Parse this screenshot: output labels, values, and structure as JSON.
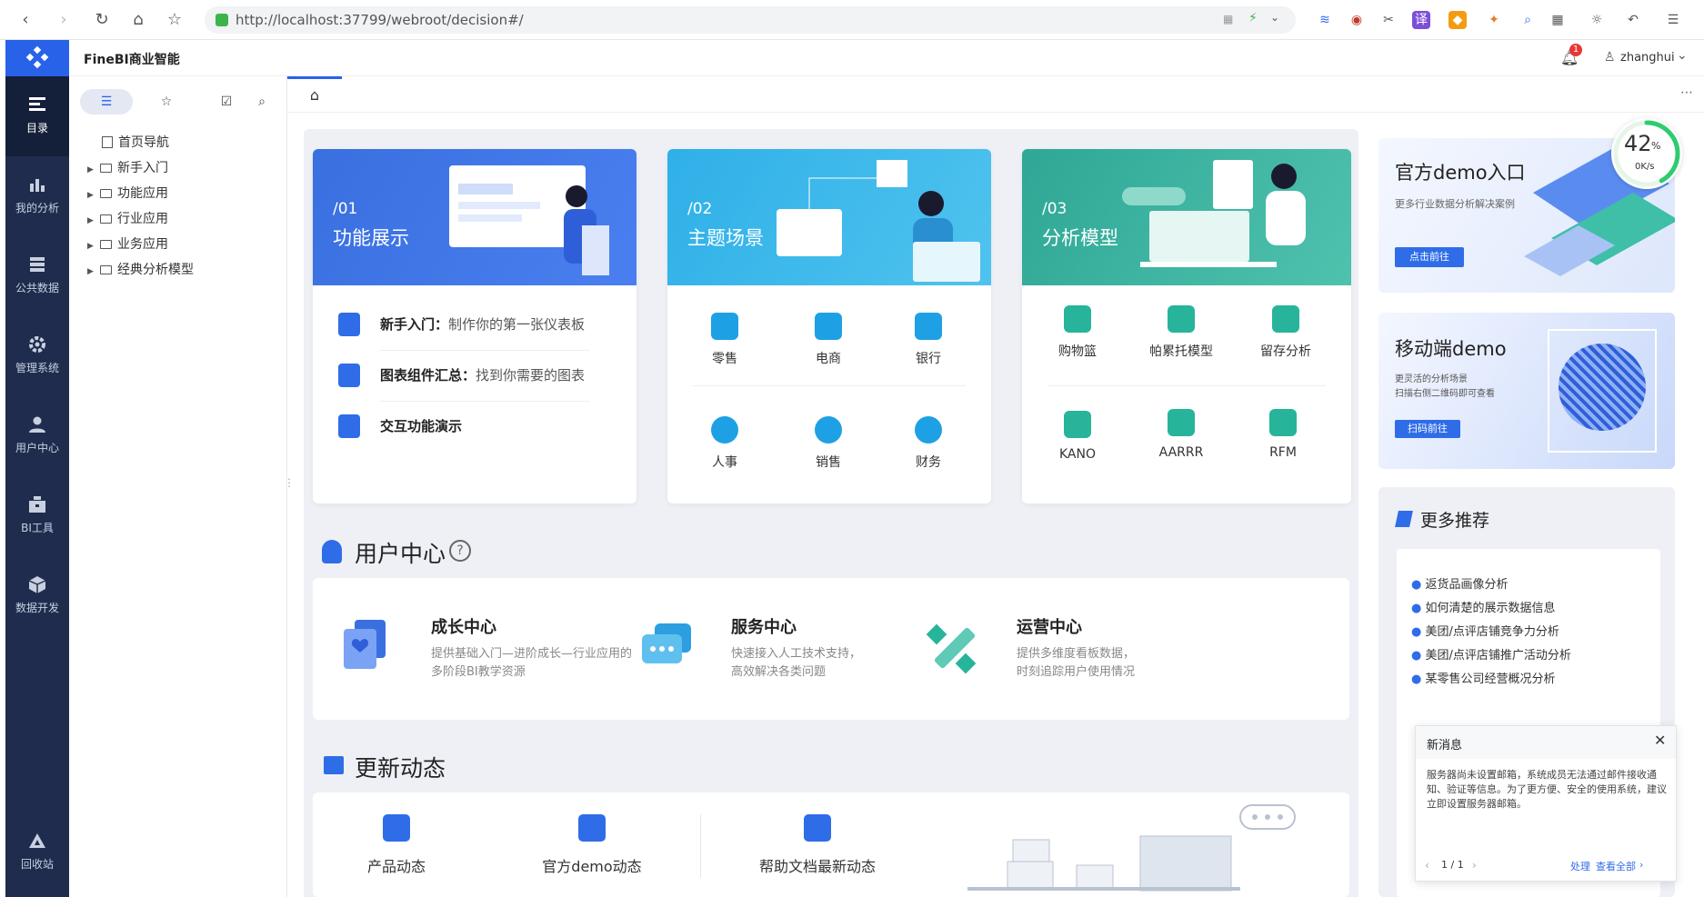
{
  "browser": {
    "url": "http://localhost:37799/webroot/decision#/"
  },
  "app": {
    "title": "FineBI商业智能",
    "user": "zhanghui",
    "notification_count": "1"
  },
  "rail": {
    "items": [
      {
        "label": "目录"
      },
      {
        "label": "我的分析"
      },
      {
        "label": "公共数据"
      },
      {
        "label": "管理系统"
      },
      {
        "label": "用户中心"
      },
      {
        "label": "BI工具"
      },
      {
        "label": "数据开发"
      }
    ],
    "bottom": {
      "label": "回收站"
    }
  },
  "directory": {
    "tree": [
      {
        "label": "首页导航"
      },
      {
        "label": "新手入门"
      },
      {
        "label": "功能应用"
      },
      {
        "label": "行业应用"
      },
      {
        "label": "业务应用"
      },
      {
        "label": "经典分析模型"
      }
    ]
  },
  "hero": {
    "cards": [
      {
        "num": "/01",
        "title": "功能展示",
        "rows": [
          {
            "bold": "新手入门：",
            "text": "制作你的第一张仪表板"
          },
          {
            "bold": "图表组件汇总：",
            "text": "找到你需要的图表"
          },
          {
            "bold": "交互功能演示",
            "text": ""
          }
        ]
      },
      {
        "num": "/02",
        "title": "主题场景",
        "items": [
          "零售",
          "电商",
          "银行",
          "人事",
          "销售",
          "财务"
        ]
      },
      {
        "num": "/03",
        "title": "分析模型",
        "items": [
          "购物篮",
          "帕累托模型",
          "留存分析",
          "KANO",
          "AARRR",
          "RFM"
        ]
      }
    ]
  },
  "user_center": {
    "title": "用户中心",
    "help": "?",
    "items": [
      {
        "title": "成长中心",
        "desc1": "提供基础入门—进阶成长—行业应用的",
        "desc2": "多阶段BI教学资源"
      },
      {
        "title": "服务中心",
        "desc1": "快速接入人工技术支持，",
        "desc2": "高效解决各类问题"
      },
      {
        "title": "运营中心",
        "desc1": "提供多维度看板数据，",
        "desc2": "时刻追踪用户使用情况"
      }
    ]
  },
  "updates": {
    "title": "更新动态",
    "items": [
      "产品动态",
      "官方demo动态",
      "帮助文档最新动态"
    ]
  },
  "right": {
    "demo": {
      "title": "官方demo入口",
      "desc": "更多行业数据分析解决案例",
      "button": "点击前往"
    },
    "mobile": {
      "title": "移动端demo",
      "desc1": "更灵活的分析场景",
      "desc2": "扫描右侧二维码即可查看",
      "button": "扫码前往"
    },
    "more": {
      "title": "更多推荐",
      "items": [
        "返货品画像分析",
        "如何清楚的展示数据信息",
        "美团/点评店铺竞争力分析",
        "美团/点评店铺推广活动分析",
        "某零售公司经营概况分析"
      ]
    },
    "gauge": {
      "percent": "42",
      "unit": "%",
      "speed": "0K/s",
      "level": 0.42
    }
  },
  "notice": {
    "title": "新消息",
    "body": "服务器尚未设置邮箱，系统成员无法通过邮件接收通知、验证等信息。为了更方便、安全的使用系统，建议立即设置服务器邮箱。",
    "pager": "1 / 1",
    "action": "处理",
    "view_all": "查看全部"
  },
  "colors": {
    "primary": "#2862e8",
    "rail": "#1f2c4d",
    "hero1": "#3a6fe0",
    "hero2": "#3cb6e6",
    "hero3": "#3db7a4"
  }
}
